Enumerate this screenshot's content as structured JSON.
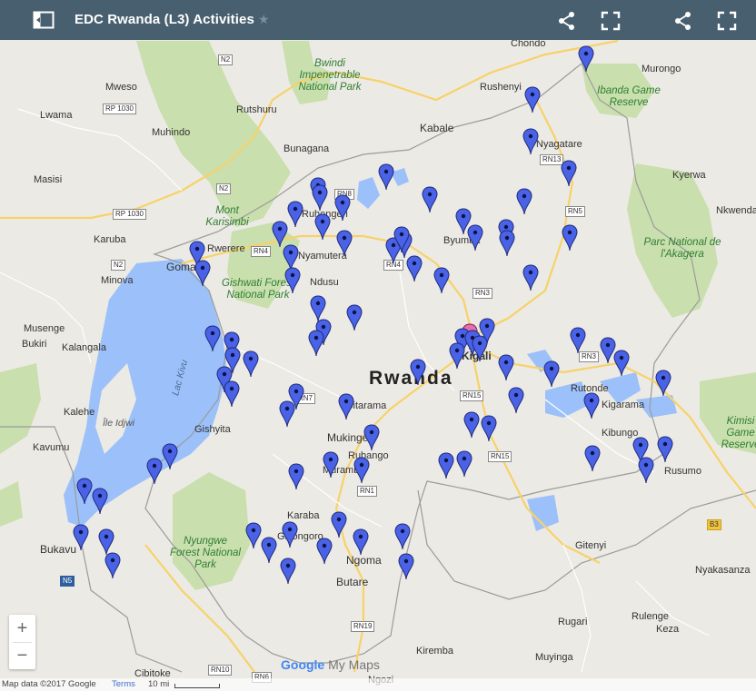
{
  "header": {
    "title": "EDC Rwanda (L3) Activities",
    "star_icon": "star-icon",
    "share_icon": "share-icon",
    "fullscreen_icon": "fullscreen-icon"
  },
  "map": {
    "country_label": "Rwanda",
    "places": [
      "Murongo",
      "Chondo",
      "Rushenyi",
      "Kabale",
      "Bunagana",
      "Rutshuru",
      "Muhindo",
      "Mweso",
      "Lwama",
      "Masisi",
      "Karuba",
      "Minova",
      "Goma",
      "Rwerere",
      "Musenge",
      "Bukiri",
      "Kalangala",
      "Kalehe",
      "Kavumu",
      "Bukavu",
      "Nyagatare",
      "Kyerwa",
      "Nkwenda",
      "Byumba",
      "Nyamutera",
      "Ruhengeri",
      "Ndusu",
      "Gishyita",
      "Rutonde",
      "Kigarama",
      "Kibungo",
      "Rusumo",
      "Mukinge",
      "Rubango",
      "Gitarama",
      "Muramba",
      "Karaba",
      "Gikongoro",
      "Ngoma",
      "Butare",
      "Nyakasanza",
      "Gitenyi",
      "Rugari",
      "Rulenge",
      "Keza",
      "Muyinga",
      "Kiremba",
      "Ngozi",
      "Cibitoke",
      "Kigali"
    ],
    "parks": [
      "Bwindi Impenetrable National Park",
      "Mont Karisimbi",
      "Gishwati Forest National Park",
      "Nyungwe Forest National Park",
      "Ibanda Game Reserve",
      "Parc National de l'Akagera",
      "Kimisi Game Reserve"
    ],
    "water": [
      "Lac Kivu",
      "Île Idjwi"
    ],
    "roads": [
      "N2",
      "RP 1030",
      "N2",
      "RP 1030",
      "N2",
      "RN8",
      "RN4",
      "RN4",
      "RN3",
      "RN13",
      "RN5",
      "RN3",
      "RN15",
      "RN15",
      "RN1",
      "RN19",
      "RN10",
      "RN6",
      "RN7",
      "B3",
      "N5"
    ],
    "marker_count": 74
  },
  "controls": {
    "zoom_in": "+",
    "zoom_out": "−"
  },
  "footer": {
    "map_data": "Map data ©2017 Google",
    "terms": "Terms",
    "scale": "10 mi",
    "brand_google": "Google",
    "brand_mymaps": "My Maps"
  }
}
